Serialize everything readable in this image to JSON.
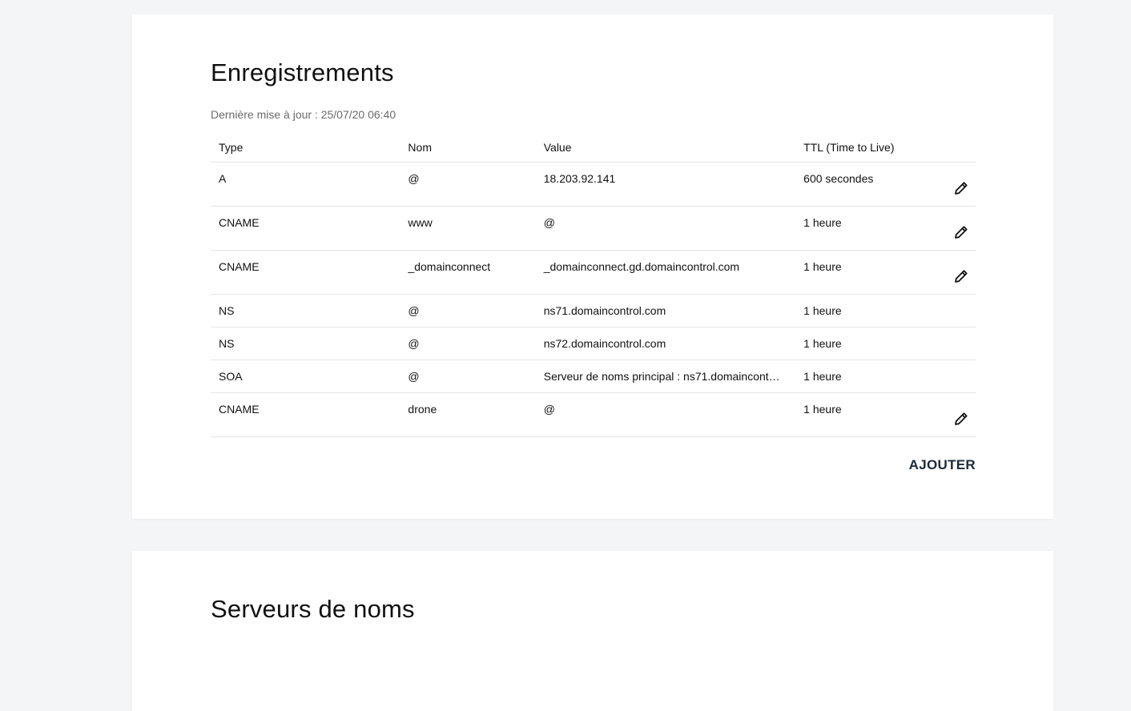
{
  "records": {
    "title": "Enregistrements",
    "last_update": "Dernière mise à jour : 25/07/20 06:40",
    "columns": {
      "type": "Type",
      "nom": "Nom",
      "value": "Value",
      "ttl": "TTL (Time to Live)"
    },
    "rows": [
      {
        "type": "A",
        "nom": "@",
        "value": "18.203.92.141",
        "ttl": "600 secondes",
        "editable": true
      },
      {
        "type": "CNAME",
        "nom": "www",
        "value": "@",
        "ttl": "1 heure",
        "editable": true
      },
      {
        "type": "CNAME",
        "nom": "_domainconnect",
        "value": "_domainconnect.gd.domaincontrol.com",
        "ttl": "1 heure",
        "editable": true
      },
      {
        "type": "NS",
        "nom": "@",
        "value": "ns71.domaincontrol.com",
        "ttl": "1 heure",
        "editable": false
      },
      {
        "type": "NS",
        "nom": "@",
        "value": "ns72.domaincontrol.com",
        "ttl": "1 heure",
        "editable": false
      },
      {
        "type": "SOA",
        "nom": "@",
        "value": "Serveur de noms principal : ns71.domaincont…",
        "ttl": "1 heure",
        "editable": false
      },
      {
        "type": "CNAME",
        "nom": "drone",
        "value": "@",
        "ttl": "1 heure",
        "editable": true
      }
    ],
    "add_label": "AJOUTER",
    "edit_icon": "pencil-icon"
  },
  "nameservers": {
    "title": "Serveurs de noms"
  },
  "colors": {
    "background": "#f4f5f7",
    "card": "#ffffff",
    "accent": "#1b2a3a",
    "muted_text": "#6b6b6b",
    "divider": "#e6e6e6"
  }
}
